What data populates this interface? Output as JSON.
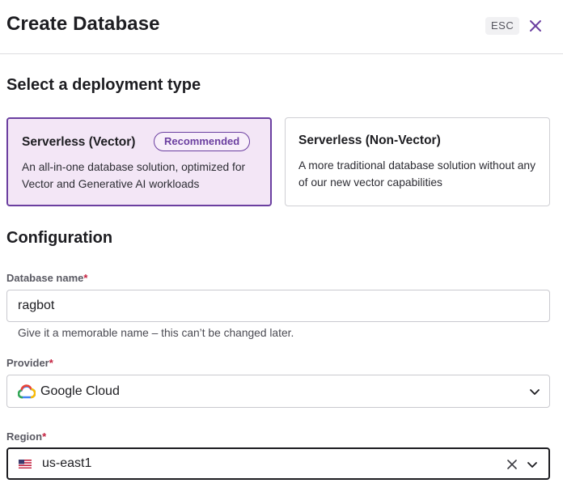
{
  "header": {
    "title": "Create Database",
    "esc_label": "ESC"
  },
  "deployment": {
    "section_title": "Select a deployment type",
    "options": [
      {
        "title": "Serverless (Vector)",
        "badge": "Recommended",
        "description": "An all-in-one database solution, optimized for Vector and Generative AI workloads",
        "selected": true
      },
      {
        "title": "Serverless (Non-Vector)",
        "description": "A more traditional database solution without any of our new vector capabilities",
        "selected": false
      }
    ]
  },
  "configuration": {
    "section_title": "Configuration",
    "database_name": {
      "label": "Database name",
      "required_marker": "*",
      "value": "ragbot",
      "helper": "Give it a memorable name – this can’t be changed later."
    },
    "provider": {
      "label": "Provider",
      "required_marker": "*",
      "value": "Google Cloud",
      "icon": "google-cloud-icon"
    },
    "region": {
      "label": "Region",
      "required_marker": "*",
      "value": "us-east1",
      "icon": "us-flag-icon"
    }
  },
  "colors": {
    "accent": "#6b3fa0",
    "selected_card_bg": "#f3e6f6",
    "required": "#c4213f"
  }
}
